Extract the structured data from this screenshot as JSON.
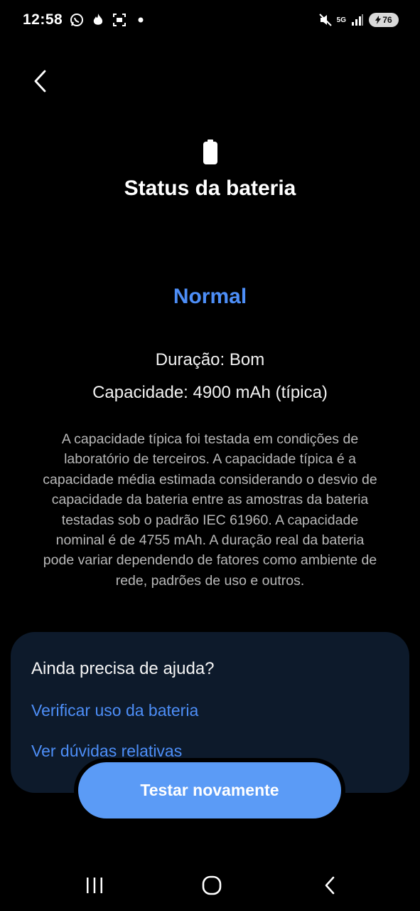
{
  "status_bar": {
    "time": "12:58",
    "network_label": "5G",
    "battery_level": "76"
  },
  "header": {
    "title": "Status da bateria"
  },
  "battery_status": {
    "status": "Normal",
    "duration": "Duração: Bom",
    "capacity": "Capacidade: 4900 mAh (típica)",
    "disclaimer": "A capacidade típica foi testada em condições de laboratório de terceiros. A capacidade típica é a capacidade média estimada considerando o desvio de capacidade da bateria entre as amostras da bateria testadas sob o padrão IEC 61960. A capacidade nominal é de 4755 mAh. A duração real da bateria pode variar dependendo de fatores como ambiente de rede, padrões de uso e outros."
  },
  "help": {
    "title": "Ainda precisa de ajuda?",
    "links": [
      {
        "label": "Verificar uso da bateria"
      },
      {
        "label": "Ver dúvidas relativas"
      }
    ]
  },
  "actions": {
    "retest_label": "Testar novamente"
  },
  "colors": {
    "accent": "#4d8ef7",
    "button": "#5b9bf6",
    "card": "#0d1a2b",
    "background": "#000000"
  },
  "icons": {
    "status_bar_left": [
      "whatsapp-icon",
      "tinder-flame-icon",
      "screenshot-icon",
      "notification-dot-icon"
    ],
    "status_bar_right": [
      "mute-icon",
      "5g-icon",
      "signal-icon",
      "battery-charging-icon"
    ],
    "header": "battery-icon",
    "nav": [
      "recents-icon",
      "home-icon",
      "back-icon"
    ]
  }
}
